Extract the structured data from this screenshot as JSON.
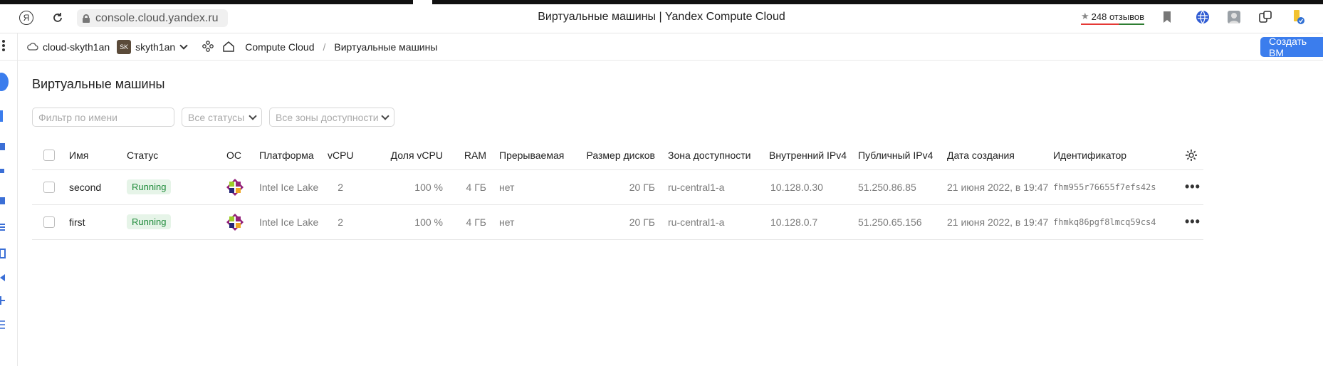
{
  "browser": {
    "url": "console.cloud.yandex.ru",
    "title": "Виртуальные машины | Yandex Compute Cloud",
    "reviews_label": "248 отзывов",
    "brand_glyph": "Я"
  },
  "header": {
    "cloud_name": "cloud-skyth1an",
    "folder_badge": "SK",
    "folder_name": "skyth1an",
    "service": "Compute Cloud",
    "separator": "/",
    "current_page": "Виртуальные машины",
    "create_button": "Создать ВМ"
  },
  "page": {
    "title": "Виртуальные машины",
    "filters": {
      "name_placeholder": "Фильтр по имени",
      "status_label": "Все статусы",
      "zone_label": "Все зоны доступности"
    }
  },
  "table": {
    "columns": [
      "Имя",
      "Статус",
      "ОС",
      "Платформа",
      "vCPU",
      "Доля vCPU",
      "RAM",
      "Прерываемая",
      "Размер дисков",
      "Зона доступности",
      "Внутренний IPv4",
      "Публичный IPv4",
      "Дата создания",
      "Идентификатор"
    ],
    "rows": [
      {
        "name": "second",
        "status": "Running",
        "platform": "Intel Ice Lake",
        "vcpu": "2",
        "vcpu_share": "100 %",
        "ram": "4 ГБ",
        "preemptible": "нет",
        "disk": "20 ГБ",
        "zone": "ru-central1-a",
        "internal_ip": "10.128.0.30",
        "public_ip": "51.250.86.85",
        "created": "21 июня 2022, в 19:47",
        "id": "fhm955r76655f7efs42s",
        "actions": "•••"
      },
      {
        "name": "first",
        "status": "Running",
        "platform": "Intel Ice Lake",
        "vcpu": "2",
        "vcpu_share": "100 %",
        "ram": "4 ГБ",
        "preemptible": "нет",
        "disk": "20 ГБ",
        "zone": "ru-central1-a",
        "internal_ip": "10.128.0.7",
        "public_ip": "51.250.65.156",
        "created": "21 июня 2022, в 19:47",
        "id": "fhmkq86pgf8lmcq59cs4",
        "actions": "•••"
      }
    ]
  },
  "colors": {
    "accent": "#3b7ded",
    "running_bg": "#e6f4e8",
    "running_text": "#1f8b3a"
  }
}
